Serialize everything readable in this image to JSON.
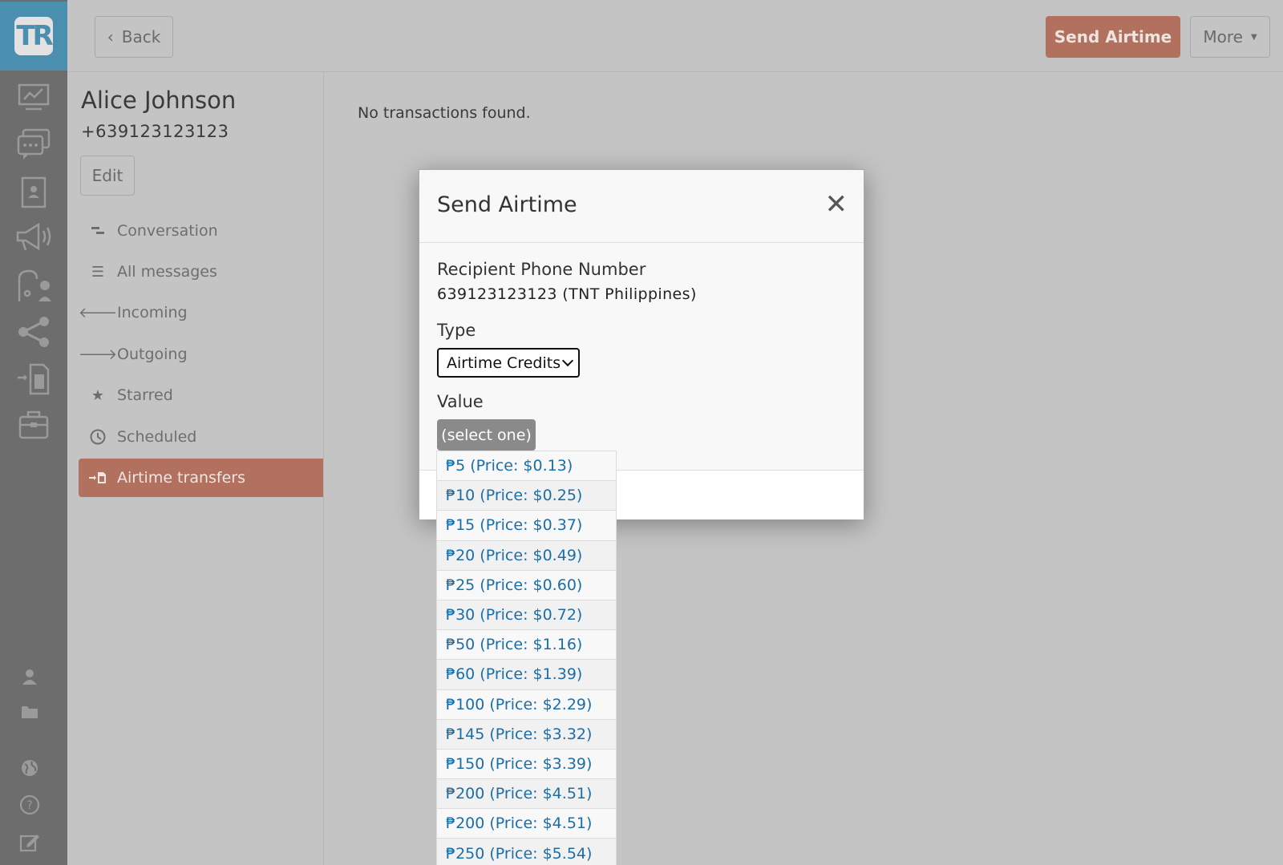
{
  "rail": {
    "logo_text": "TR",
    "icons": [
      "dashboard-icon",
      "messages-icon",
      "contacts-icon",
      "campaigns-icon",
      "flows-icon",
      "share-icon",
      "airtime-icon",
      "jobs-icon",
      "user-icon",
      "folder-icon",
      "globe-icon",
      "help-icon",
      "edit-icon"
    ]
  },
  "topbar": {
    "back_label": "Back",
    "send_airtime_label": "Send Airtime",
    "more_label": "More"
  },
  "contact": {
    "name": "Alice Johnson",
    "phone": "+639123123123",
    "edit_label": "Edit"
  },
  "nav": {
    "items": [
      {
        "label": "Conversation",
        "icon": "conversation-icon"
      },
      {
        "label": "All messages",
        "icon": "list-icon"
      },
      {
        "label": "Incoming",
        "icon": "arrow-left-icon"
      },
      {
        "label": "Outgoing",
        "icon": "arrow-right-icon"
      },
      {
        "label": "Starred",
        "icon": "star-icon"
      },
      {
        "label": "Scheduled",
        "icon": "clock-icon"
      },
      {
        "label": "Airtime transfers",
        "icon": "airtime-transfer-icon",
        "active": true
      }
    ]
  },
  "main": {
    "empty_message": "No transactions found."
  },
  "modal": {
    "title": "Send Airtime",
    "recipient_label": "Recipient Phone Number",
    "recipient_value": "639123123123 (TNT Philippines)",
    "type_label": "Type",
    "type_selected": "Airtime Credits",
    "value_label": "Value",
    "value_placeholder": "(select one)"
  },
  "dropdown": {
    "options": [
      "₱5 (Price: $0.13)",
      "₱10 (Price: $0.25)",
      "₱15 (Price: $0.37)",
      "₱20 (Price: $0.49)",
      "₱25 (Price: $0.60)",
      "₱30 (Price: $0.72)",
      "₱50 (Price: $1.16)",
      "₱60 (Price: $1.39)",
      "₱100 (Price: $2.29)",
      "₱145 (Price: $3.32)",
      "₱150 (Price: $3.39)",
      "₱200 (Price: $4.51)",
      "₱200 (Price: $4.51)",
      "₱250 (Price: $5.54)"
    ]
  },
  "colors": {
    "accent": "#b2705e",
    "rail": "#6d6d6d",
    "logo_bg": "#4b8fb0",
    "link": "#1b6ea5"
  }
}
